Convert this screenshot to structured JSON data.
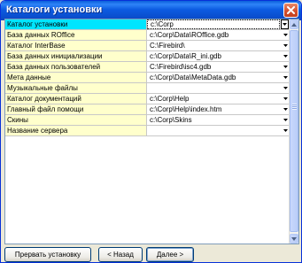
{
  "window": {
    "title": "Каталоги установки"
  },
  "grid": {
    "rows": [
      {
        "label": "Каталог установки",
        "value": "c:\\Corp",
        "selected": true
      },
      {
        "label": "База данных ROffice",
        "value": "c:\\Corp\\Data\\ROffice.gdb"
      },
      {
        "label": "Каталог InterBase",
        "value": "C:\\Firebird\\"
      },
      {
        "label": "База данных инициализации",
        "value": "c:\\Corp\\Data\\R_ini.gdb"
      },
      {
        "label": "База данных пользователей",
        "value": "C:\\Firebird\\isc4.gdb"
      },
      {
        "label": "Мета данные",
        "value": "c:\\Corp\\Data\\MetaData.gdb"
      },
      {
        "label": "Музыкальные файлы",
        "value": ""
      },
      {
        "label": "Каталог документаций",
        "value": "c:\\Corp\\Help"
      },
      {
        "label": "Главный файл помощи",
        "value": "c:\\Corp\\Help\\index.htm"
      },
      {
        "label": "Скины",
        "value": "c:\\Corp\\Skins"
      },
      {
        "label": "Название сервера",
        "value": ""
      }
    ]
  },
  "buttons": {
    "cancel_label": "Прервать установку",
    "back_label": "< Назад",
    "next_label": "Далее >"
  },
  "colors": {
    "title_bar": "#0A5FDB",
    "label_bg": "#FFFFCC",
    "selected_label_bg": "#00E5FF"
  },
  "icons": {
    "close": "close-icon",
    "dropdown": "chevron-down-icon",
    "scroll_up": "scroll-up-arrow-icon",
    "scroll_down": "scroll-down-arrow-icon"
  }
}
